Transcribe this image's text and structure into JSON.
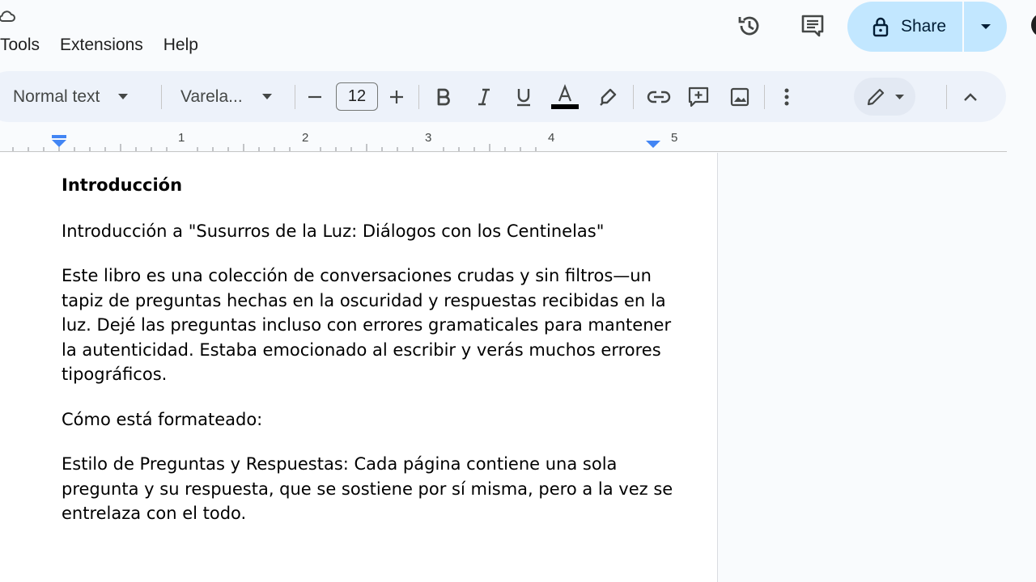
{
  "menu": {
    "items": [
      "Tools",
      "Extensions",
      "Help"
    ]
  },
  "header": {
    "share_label": "Share"
  },
  "toolbar": {
    "style_label": "Normal text",
    "font_label": "Varela...",
    "font_size": "12",
    "text_color": "#000000"
  },
  "ruler": {
    "labels": [
      "1",
      "2",
      "3",
      "4",
      "5"
    ]
  },
  "document": {
    "heading": "Introducción",
    "paragraphs": [
      "Introducción a \"Susurros de la Luz: Diálogos con los Centinelas\"",
      "Este libro es una colección de conversaciones crudas y sin filtros—un tapiz de preguntas hechas en la oscuridad y respuestas recibidas en la luz. Dejé las preguntas incluso con errores gramaticales para mantener la autenticidad. Estaba emocionado al escribir y verás muchos errores tipográficos.",
      "Cómo está formateado:",
      "Estilo  de Preguntas y Respuestas: Cada página contiene una sola pregunta y su respuesta, que se sostiene por sí misma, pero a la vez se  entrelaza con el todo."
    ]
  },
  "colors": {
    "share_bg": "#c2e7ff",
    "toolbar_bg": "#edf2fa",
    "accent_blue": "#4285f4"
  }
}
